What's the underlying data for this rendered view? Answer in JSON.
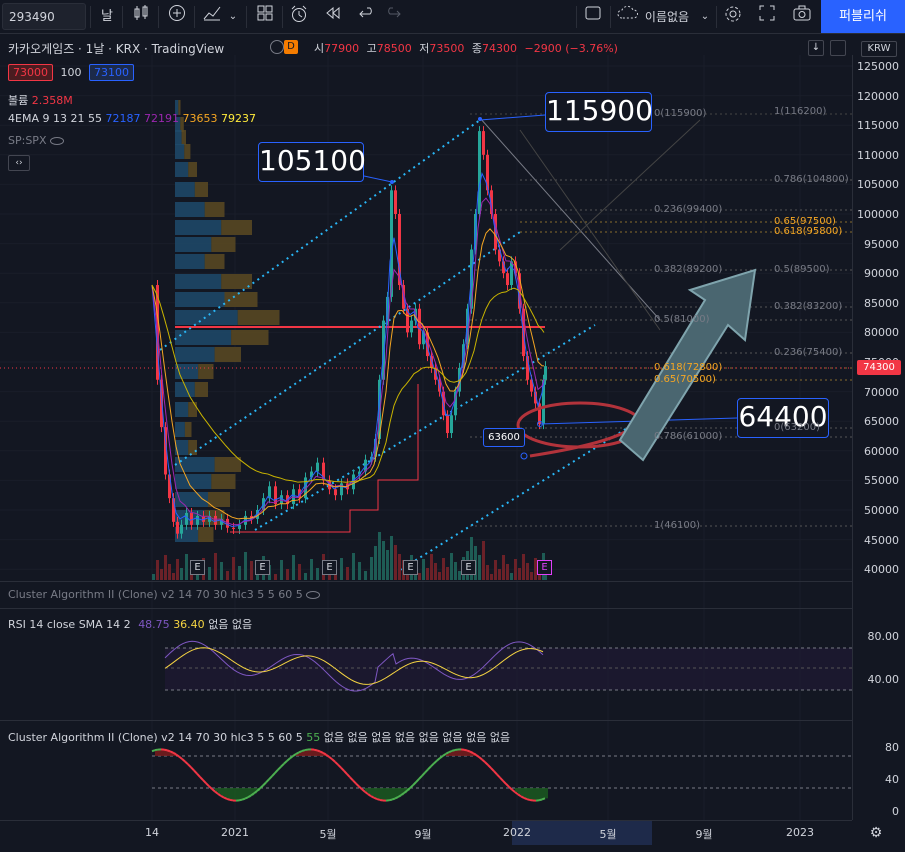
{
  "toolbar": {
    "symbol": "293490",
    "interval": "날",
    "chart_name": "이름없음",
    "publish": "퍼블리쉬"
  },
  "header": {
    "title": "카카오게임즈 · 1날 · KRX · TradingView",
    "d_badge": "D",
    "ohlc": [
      {
        "k": "시",
        "v": "77900"
      },
      {
        "k": "고",
        "v": "78500"
      },
      {
        "k": "저",
        "v": "73500"
      },
      {
        "k": "종",
        "v": "74300"
      }
    ],
    "change": "−2900 (−3.76%)",
    "bid": "73000",
    "spread": "100",
    "ask": "73100"
  },
  "legends": {
    "volume_label": "볼륨",
    "volume_value": "2.358M",
    "ema_label": "4EMA 9 13 21 55",
    "ema_values": [
      "72187",
      "72191",
      "73653",
      "79237"
    ],
    "sp": "SP:SPX",
    "cluster1": "Cluster Algorithm II (Clone) v2 14 70 30 hlc3 5 5 60 5",
    "rsi_label": "RSI 14 close SMA 14 2",
    "rsi_val1": "48.75",
    "rsi_val2": "36.40",
    "rsi_none": "없음 없음",
    "cluster2_label": "Cluster Algorithm II (Clone) v2 14 70 30 hlc3 5 5 60 5",
    "cluster2_val": "55",
    "cluster2_none": "없음 없음 없음 없음 없음 없음 없음 없음"
  },
  "price_axis": {
    "currency": "KRW",
    "labels": [
      "125000",
      "120000",
      "115000",
      "110000",
      "105000",
      "100000",
      "95000",
      "90000",
      "85000",
      "80000",
      "75000",
      "70000",
      "65000",
      "60000",
      "55000",
      "50000",
      "45000",
      "40000"
    ],
    "current": "74300",
    "rsi_labels": [
      "80.00",
      "40.00"
    ],
    "cluster_labels": [
      "80",
      "40",
      "0"
    ]
  },
  "time_axis": {
    "labels": [
      "14",
      "2021",
      "5월",
      "9월",
      "2022",
      "5월",
      "9월",
      "2023"
    ]
  },
  "callouts": {
    "peak1": "105100",
    "peak2": "115900",
    "low": "64400",
    "low_small": "63600"
  },
  "fib_left": [
    {
      "t": "0(115900)",
      "c": "#787b86"
    },
    {
      "t": "0.236(99400)",
      "c": "#787b86"
    },
    {
      "t": "0.382(89200)",
      "c": "#787b86"
    },
    {
      "t": "0.5(81000)",
      "c": "#787b86"
    },
    {
      "t": "0.618(72800)",
      "c": "#f5a623"
    },
    {
      "t": "0.65(70500)",
      "c": "#f5a623"
    },
    {
      "t": "0.786(61000)",
      "c": "#787b86"
    },
    {
      "t": "1(46100)",
      "c": "#787b86"
    }
  ],
  "fib_right": [
    {
      "t": "1(116200)",
      "c": "#787b86"
    },
    {
      "t": "0.786(104800)",
      "c": "#787b86"
    },
    {
      "t": "0.65(97500)",
      "c": "#f5a623"
    },
    {
      "t": "0.618(95800)",
      "c": "#f5a623"
    },
    {
      "t": "0.5(89500)",
      "c": "#787b86"
    },
    {
      "t": "0.382(83200)",
      "c": "#787b86"
    },
    {
      "t": "0.236(75400)",
      "c": "#787b86"
    },
    {
      "t": "0(63200)",
      "c": "#787b86"
    }
  ],
  "colors": {
    "up": "#26a69a",
    "down": "#f23645",
    "accent": "#2962ff",
    "fib_gold": "#f5a623"
  }
}
